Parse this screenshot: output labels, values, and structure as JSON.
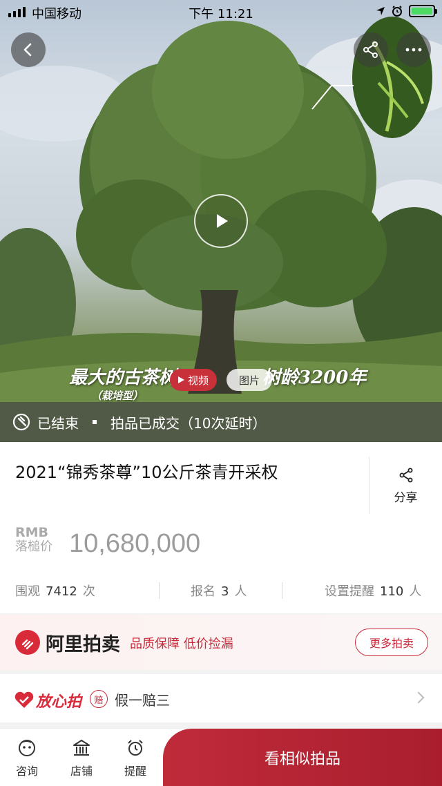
{
  "status_bar": {
    "carrier": "中国移动",
    "time": "下午 11:21"
  },
  "hero": {
    "overlay_left": "最大的古茶树",
    "overlay_left_sub": "（栽培型）",
    "overlay_right": "树龄3200年",
    "video_chip": "视频",
    "photo_chip": "图片",
    "status": "已结束",
    "result": "拍品已成交（10次延时）"
  },
  "item": {
    "title": "2021“锦秀茶尊”10公斤茶青开采权",
    "share_label": "分享",
    "price_currency": "RMB",
    "price_label": "落槌价",
    "price_value": "10,680,000"
  },
  "stats": {
    "views_label": "围观",
    "views_value": "7412",
    "views_unit": "次",
    "signup_label": "报名",
    "signup_value": "3",
    "signup_unit": "人",
    "remind_label": "设置提醒",
    "remind_value": "110",
    "remind_unit": "人"
  },
  "ali": {
    "name": "阿里拍卖",
    "slogan": "品质保障 低价捡漏",
    "more_button": "更多拍卖"
  },
  "guarantee": {
    "brand": "放心拍",
    "badge": "赔",
    "text": "假一赔三"
  },
  "bottom_bar": {
    "tab_consult": "咨询",
    "tab_shop": "店铺",
    "tab_remind": "提醒",
    "cta": "看相似拍品"
  },
  "colors": {
    "accent_red": "#c92838",
    "cta_red": "#b42434",
    "battery_green": "#4cd964"
  }
}
